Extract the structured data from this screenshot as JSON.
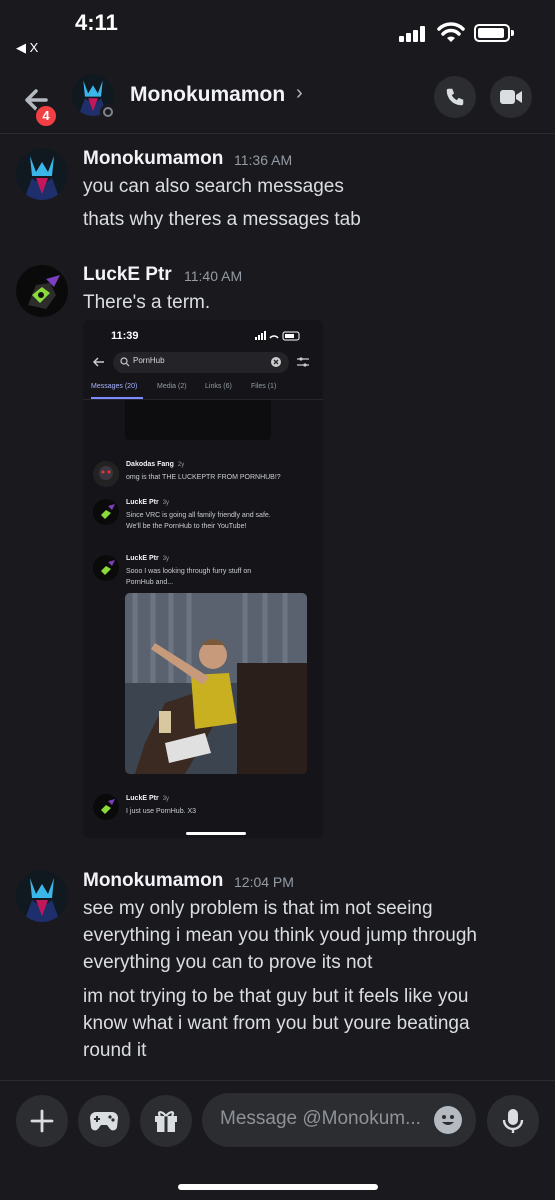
{
  "status_bar": {
    "time": "4:11",
    "back_app": "◀ X"
  },
  "header": {
    "unread_count": "4",
    "contact_name": "Monokumamon",
    "chevron": "›"
  },
  "messages": [
    {
      "author": "Monokumamon",
      "time": "11:36 AM",
      "lines": [
        "you can also search messages",
        "thats why theres a messages tab"
      ]
    },
    {
      "author": "LuckE Ptr",
      "time": "11:40 AM",
      "lines": [
        "There's a term."
      ]
    },
    {
      "author": "Monokumamon",
      "time": "12:04 PM",
      "lines": [
        "see my only problem is that im not seeing",
        "everything i mean you think youd jump through",
        "everything you can to prove its not",
        "im not trying to be that guy but it feels like you",
        "know what i want from you but youre beatinga",
        "round it"
      ]
    }
  ],
  "embed": {
    "time": "11:39",
    "search_query": "PornHub",
    "tabs": [
      "Messages (20)",
      "Media (2)",
      "Links (6)",
      "Files (1)"
    ],
    "results": [
      {
        "author": "Dakodas Fang",
        "when": "2y",
        "lines": [
          "omg is that THE LUCKEPTR FROM PORNHUB!?"
        ]
      },
      {
        "author": "LuckE Ptr",
        "when": "3y",
        "lines": [
          "Since VRC is going all family friendly and safe.",
          "We'll be the PornHub to their YouTube!"
        ]
      },
      {
        "author": "LuckE Ptr",
        "when": "3y",
        "lines": [
          "Sooo I was looking through furry stuff on",
          "PornHub and..."
        ]
      },
      {
        "author": "LuckE Ptr",
        "when": "3y",
        "lines": [
          "I just use PornHub. X3"
        ]
      }
    ]
  },
  "composer": {
    "placeholder": "Message @Monokum..."
  },
  "colors": {
    "background": "#1a1a1e",
    "badge": "#f23f43",
    "tab_active": "#a8b2ff"
  }
}
